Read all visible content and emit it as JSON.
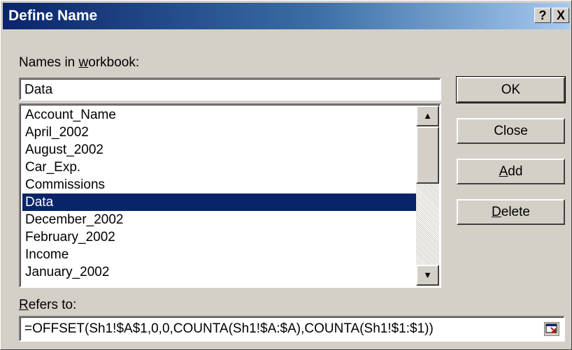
{
  "window": {
    "title": "Define Name",
    "help_label": "?",
    "close_label": "X"
  },
  "names_label": {
    "before": "Names in ",
    "accel": "w",
    "after": "orkbook:"
  },
  "names_input_value": "Data",
  "list": {
    "items": [
      "Account_Name",
      "April_2002",
      "August_2002",
      "Car_Exp.",
      "Commissions",
      "Data",
      "December_2002",
      "February_2002",
      "Income",
      "January_2002"
    ],
    "selected": "Data"
  },
  "scrollbar": {
    "up_icon": "▲",
    "down_icon": "▼"
  },
  "buttons": {
    "ok": "OK",
    "close": "Close",
    "add": {
      "accel": "A",
      "rest": "dd"
    },
    "delete": {
      "accel": "D",
      "rest": "elete"
    }
  },
  "refers_label": {
    "accel": "R",
    "rest": "efers to:"
  },
  "refers_value": "=OFFSET(Sh1!$A$1,0,0,COUNTA(Sh1!$A:$A),COUNTA(Sh1!$1:$1))",
  "colors": {
    "title_start": "#0a246a",
    "title_end": "#a6caf0",
    "selection": "#0a246a",
    "face": "#d4d0c8"
  }
}
